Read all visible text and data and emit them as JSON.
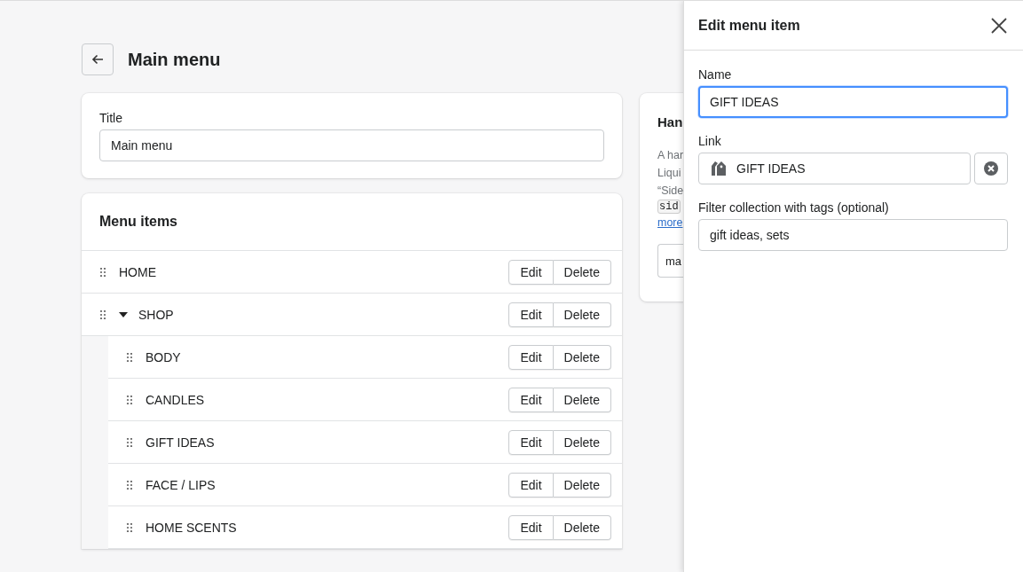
{
  "page": {
    "title": "Main menu"
  },
  "title_card": {
    "label": "Title",
    "value": "Main menu"
  },
  "menu_items": {
    "heading": "Menu items",
    "items": [
      {
        "label": "HOME",
        "edit_label": "Edit",
        "delete_label": "Delete"
      },
      {
        "label": "SHOP",
        "edit_label": "Edit",
        "delete_label": "Delete",
        "expanded": true,
        "children": [
          {
            "label": "BODY",
            "edit_label": "Edit",
            "delete_label": "Delete"
          },
          {
            "label": "CANDLES",
            "edit_label": "Edit",
            "delete_label": "Delete"
          },
          {
            "label": "GIFT IDEAS",
            "edit_label": "Edit",
            "delete_label": "Delete"
          },
          {
            "label": "FACE / LIPS",
            "edit_label": "Edit",
            "delete_label": "Delete"
          },
          {
            "label": "HOME SCENTS",
            "edit_label": "Edit",
            "delete_label": "Delete"
          }
        ]
      }
    ]
  },
  "handle_card": {
    "heading": "Han",
    "lines": [
      "A har",
      "Liqui",
      "“Side"
    ],
    "code": "sid",
    "link": "more",
    "field_value": "ma"
  },
  "panel": {
    "title": "Edit menu item",
    "name_label": "Name",
    "name_value": "GIFT IDEAS",
    "name_focused": true,
    "link_label": "Link",
    "link_value": "GIFT IDEAS",
    "filter_label": "Filter collection with tags (optional)",
    "filter_value": "gift ideas, sets"
  }
}
